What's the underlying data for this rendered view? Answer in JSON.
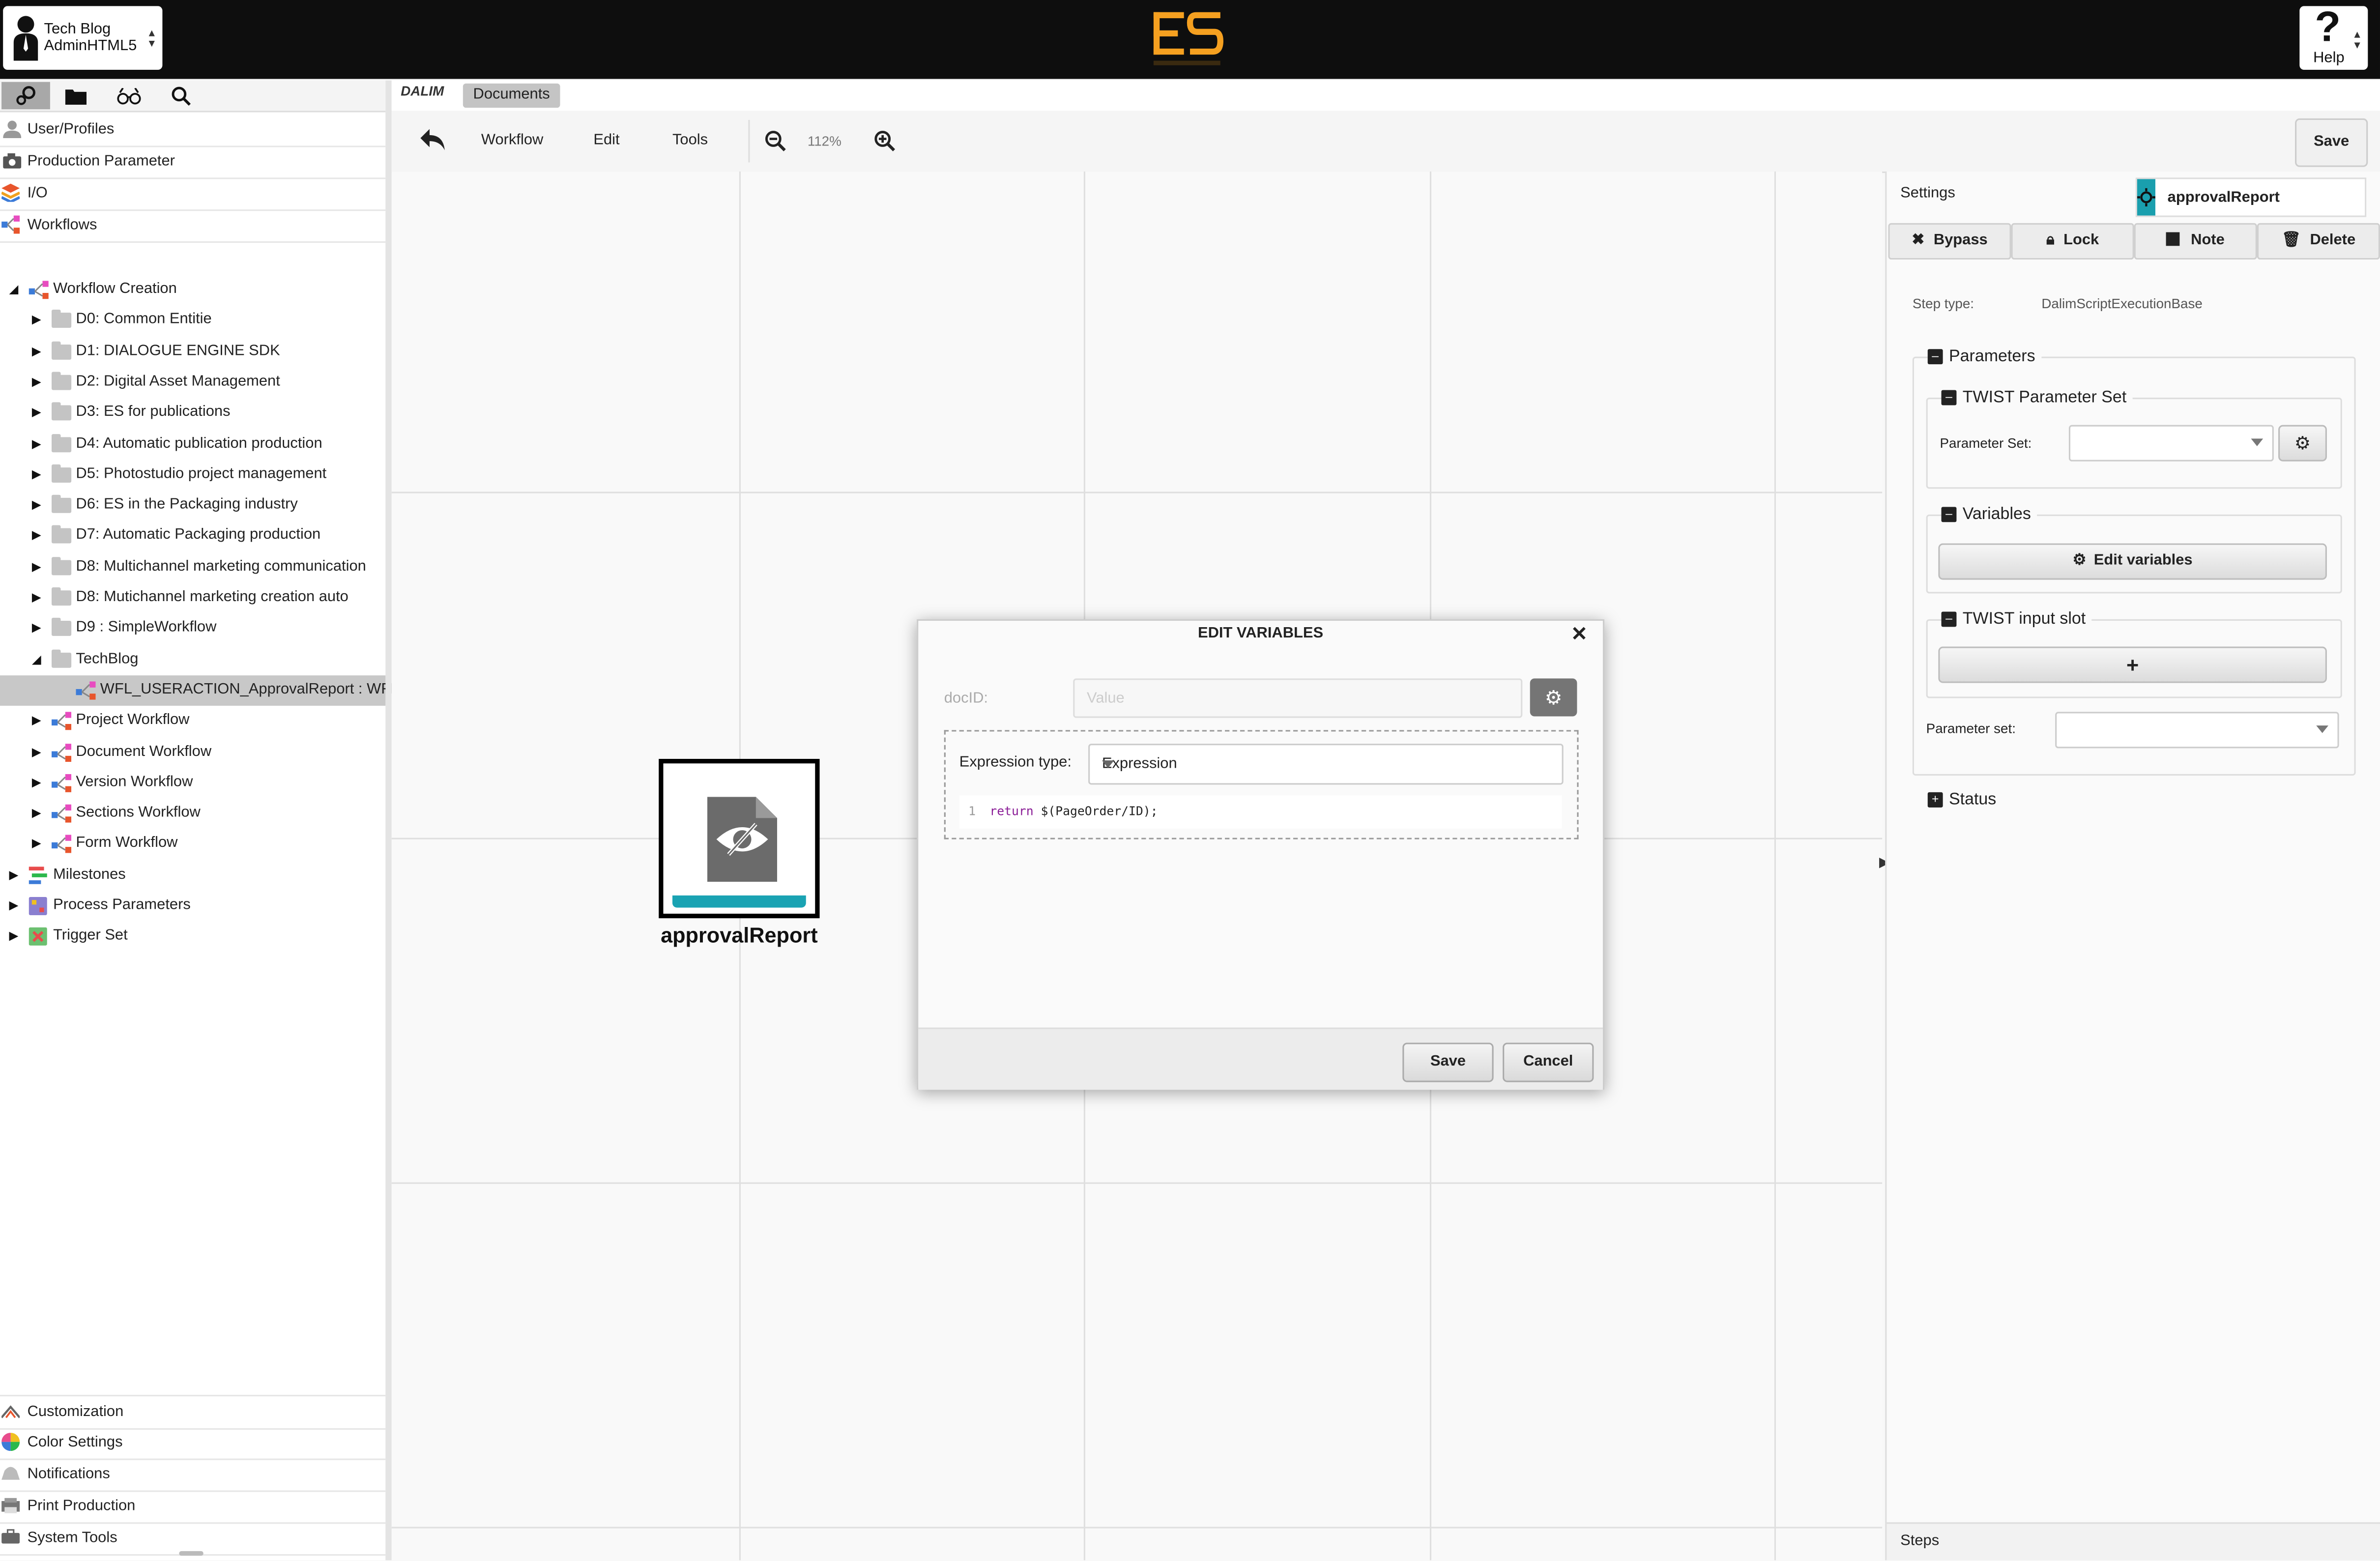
{
  "account": {
    "line1": "Tech Blog",
    "line2": "AdminHTML5"
  },
  "help": {
    "label": "Help",
    "glyph": "?"
  },
  "logo": {
    "text": "ES",
    "color": "#f5a020"
  },
  "sidebar": {
    "top_items": [
      {
        "label": "User/Profiles",
        "icon": "user-icon"
      },
      {
        "label": "Production Parameter",
        "icon": "camera-icon"
      },
      {
        "label": "I/O",
        "icon": "layers-icon"
      },
      {
        "label": "Workflows",
        "icon": "workflow-icon"
      }
    ],
    "tree": [
      {
        "label": "Workflow Creation",
        "indent": 1,
        "arrow": "open",
        "icon": "workflow"
      },
      {
        "label": "D0: Common Entitie",
        "indent": 2,
        "arrow": "closed",
        "icon": "folder"
      },
      {
        "label": "D1: DIALOGUE ENGINE SDK",
        "indent": 2,
        "arrow": "closed",
        "icon": "folder"
      },
      {
        "label": "D2: Digital Asset Management",
        "indent": 2,
        "arrow": "closed",
        "icon": "folder"
      },
      {
        "label": "D3: ES for publications",
        "indent": 2,
        "arrow": "closed",
        "icon": "folder"
      },
      {
        "label": "D4: Automatic publication production",
        "indent": 2,
        "arrow": "closed",
        "icon": "folder"
      },
      {
        "label": "D5: Photostudio project management",
        "indent": 2,
        "arrow": "closed",
        "icon": "folder"
      },
      {
        "label": "D6: ES in the Packaging industry",
        "indent": 2,
        "arrow": "closed",
        "icon": "folder"
      },
      {
        "label": "D7: Automatic Packaging production",
        "indent": 2,
        "arrow": "closed",
        "icon": "folder"
      },
      {
        "label": "D8: Multichannel marketing communication",
        "indent": 2,
        "arrow": "closed",
        "icon": "folder"
      },
      {
        "label": "D8: Mutichannel marketing creation auto",
        "indent": 2,
        "arrow": "closed",
        "icon": "folder"
      },
      {
        "label": "D9 : SimpleWorkflow",
        "indent": 2,
        "arrow": "closed",
        "icon": "folder"
      },
      {
        "label": "TechBlog",
        "indent": 2,
        "arrow": "open",
        "icon": "folder"
      },
      {
        "label": "WFL_USERACTION_ApprovalReport : WFL for",
        "indent": 3,
        "arrow": "none",
        "icon": "workflow",
        "selected": true
      },
      {
        "label": "Project Workflow",
        "indent": 2,
        "arrow": "closed",
        "icon": "workflow"
      },
      {
        "label": "Document Workflow",
        "indent": 2,
        "arrow": "closed",
        "icon": "workflow"
      },
      {
        "label": "Version Workflow",
        "indent": 2,
        "arrow": "closed",
        "icon": "workflow"
      },
      {
        "label": "Sections Workflow",
        "indent": 2,
        "arrow": "closed",
        "icon": "workflow"
      },
      {
        "label": "Form Workflow",
        "indent": 2,
        "arrow": "closed",
        "icon": "workflow"
      },
      {
        "label": "Milestones",
        "indent": 1,
        "arrow": "closed",
        "icon": "milestones"
      },
      {
        "label": "Process Parameters",
        "indent": 1,
        "arrow": "closed",
        "icon": "params"
      },
      {
        "label": "Trigger Set",
        "indent": 1,
        "arrow": "closed",
        "icon": "trigger"
      }
    ],
    "bottom_items": [
      {
        "label": "Customization",
        "icon": "customization-icon"
      },
      {
        "label": "Color Settings",
        "icon": "color-wheel-icon"
      },
      {
        "label": "Notifications",
        "icon": "bell-icon"
      },
      {
        "label": "Print Production",
        "icon": "printer-icon"
      },
      {
        "label": "System Tools",
        "icon": "tools-icon"
      }
    ]
  },
  "docbar": {
    "brand": "DALIM",
    "tab": "Documents"
  },
  "toolbar": {
    "menus": [
      "Workflow",
      "Edit",
      "Tools"
    ],
    "zoom": "112%",
    "save": "Save"
  },
  "node": {
    "label": "approvalReport",
    "accent": "#1aa3b3"
  },
  "panel": {
    "settings": "Settings",
    "step_name": "approvalReport",
    "buttons": [
      "Bypass",
      "Lock",
      "Note",
      "Delete"
    ],
    "step_type_label": "Step type:",
    "step_type_value": "DalimScriptExecutionBase",
    "parameters": "Parameters",
    "twist_param_set": "TWIST Parameter Set",
    "param_set_label": "Parameter Set:",
    "variables": "Variables",
    "edit_variables": "Edit variables",
    "twist_input_slot": "TWIST input slot",
    "add_glyph": "+",
    "param_set2_label": "Parameter set:",
    "status": "Status",
    "steps": "Steps"
  },
  "dialog": {
    "title": "EDIT VARIABLES",
    "doc_label": "docID:",
    "doc_placeholder": "Value",
    "expr_type_label": "Expression type:",
    "expr_type_value": "Expression",
    "code_line_number": "1",
    "code_keyword": "return",
    "code_rest": " $(PageOrder/ID);",
    "save": "Save",
    "cancel": "Cancel"
  }
}
